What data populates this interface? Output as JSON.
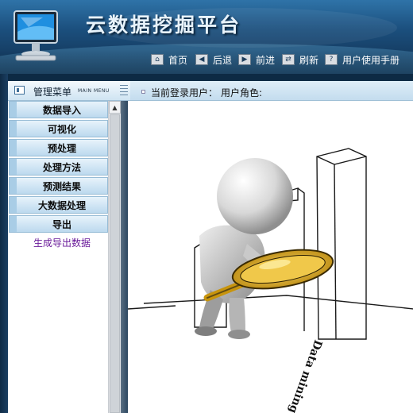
{
  "header": {
    "app_title": "云数据挖掘平台",
    "nav": [
      {
        "label": "首页",
        "icon": "home-icon"
      },
      {
        "label": "后退",
        "icon": "back-arrow-icon"
      },
      {
        "label": "前进",
        "icon": "forward-arrow-icon"
      },
      {
        "label": "刷新",
        "icon": "refresh-icon"
      },
      {
        "label": "用户使用手册",
        "icon": "help-icon"
      }
    ]
  },
  "menu": {
    "title": "管理菜单",
    "subtitle": "MAIN MENU",
    "items": [
      {
        "label": "数据导入"
      },
      {
        "label": "可视化"
      },
      {
        "label": "预处理"
      },
      {
        "label": "处理方法"
      },
      {
        "label": "预测结果"
      },
      {
        "label": "大数据处理"
      },
      {
        "label": "导出"
      }
    ],
    "sub_link": "生成导出数据"
  },
  "info_bar": {
    "current_user_label": "当前登录用户：",
    "user_role_label": "用户角色:"
  },
  "illustration": {
    "caption": "Data mining"
  },
  "colors": {
    "header_blue": "#1b4f7d",
    "menu_item_bg": "#bcd9ee",
    "sub_link": "#6a1b9a"
  }
}
